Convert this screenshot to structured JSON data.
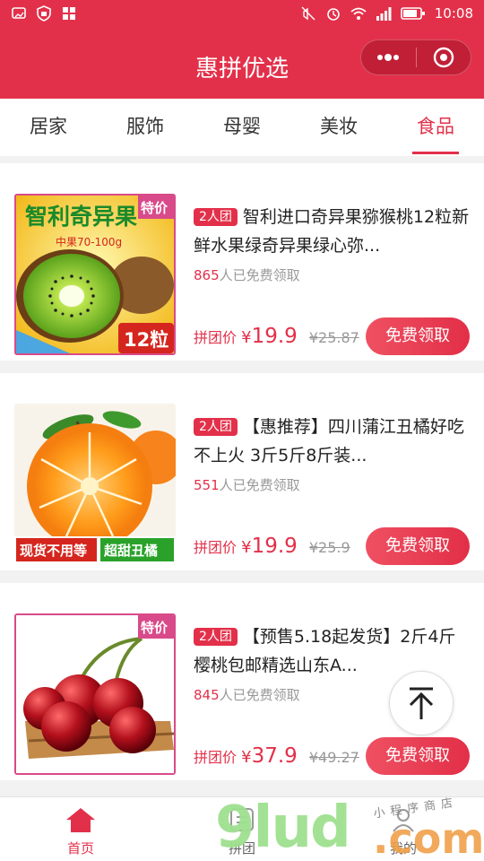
{
  "status_bar": {
    "time": "10:08"
  },
  "header": {
    "title": "惠拼优选"
  },
  "tabs": [
    {
      "label": "居家"
    },
    {
      "label": "服饰"
    },
    {
      "label": "母婴"
    },
    {
      "label": "美妆"
    },
    {
      "label": "食品"
    }
  ],
  "active_tab": "食品",
  "products": [
    {
      "team": "2人团",
      "title": "智利进口奇异果猕猴桃12粒新鲜水果绿奇异果绿心弥...",
      "claimed_num": "865",
      "claimed_text": "人已免费领取",
      "price_label": "拼团价",
      "currency": "¥",
      "price": "19.9",
      "orig_price": "¥25.87",
      "button": "免费领取",
      "image_text": {
        "headline": "智利奇异果",
        "sub": "中果70-100g",
        "tag": "特价",
        "count": "12粒"
      }
    },
    {
      "team": "2人团",
      "title": "【惠推荐】四川蒲江丑橘好吃不上火 3斤5斤8斤装...",
      "claimed_num": "551",
      "claimed_text": "人已免费领取",
      "price_label": "拼团价",
      "currency": "¥",
      "price": "19.9",
      "orig_price": "¥25.9",
      "button": "免费领取",
      "image_text": {
        "left": "现货不用等",
        "right": "超甜丑橘"
      }
    },
    {
      "team": "2人团",
      "title": "【预售5.18起发货】2斤4斤樱桃包邮精选山东A...",
      "claimed_num": "845",
      "claimed_text": "人已免费领取",
      "price_label": "拼团价",
      "currency": "¥",
      "price": "37.9",
      "orig_price": "¥49.27",
      "button": "免费领取",
      "image_text": {
        "tag": "特价"
      }
    }
  ],
  "tabbar": [
    {
      "label": "首页",
      "icon": "home-icon"
    },
    {
      "label": "拼团",
      "icon": "group-icon"
    },
    {
      "label": "我的",
      "icon": "profile-icon"
    }
  ],
  "watermark": {
    "main": "9lud",
    "sub": ".com",
    "small": "小程序商店"
  },
  "colors": {
    "brand": "#e3304a",
    "watermark_green": "#9fe08f",
    "watermark_orange": "#f0a04a"
  }
}
